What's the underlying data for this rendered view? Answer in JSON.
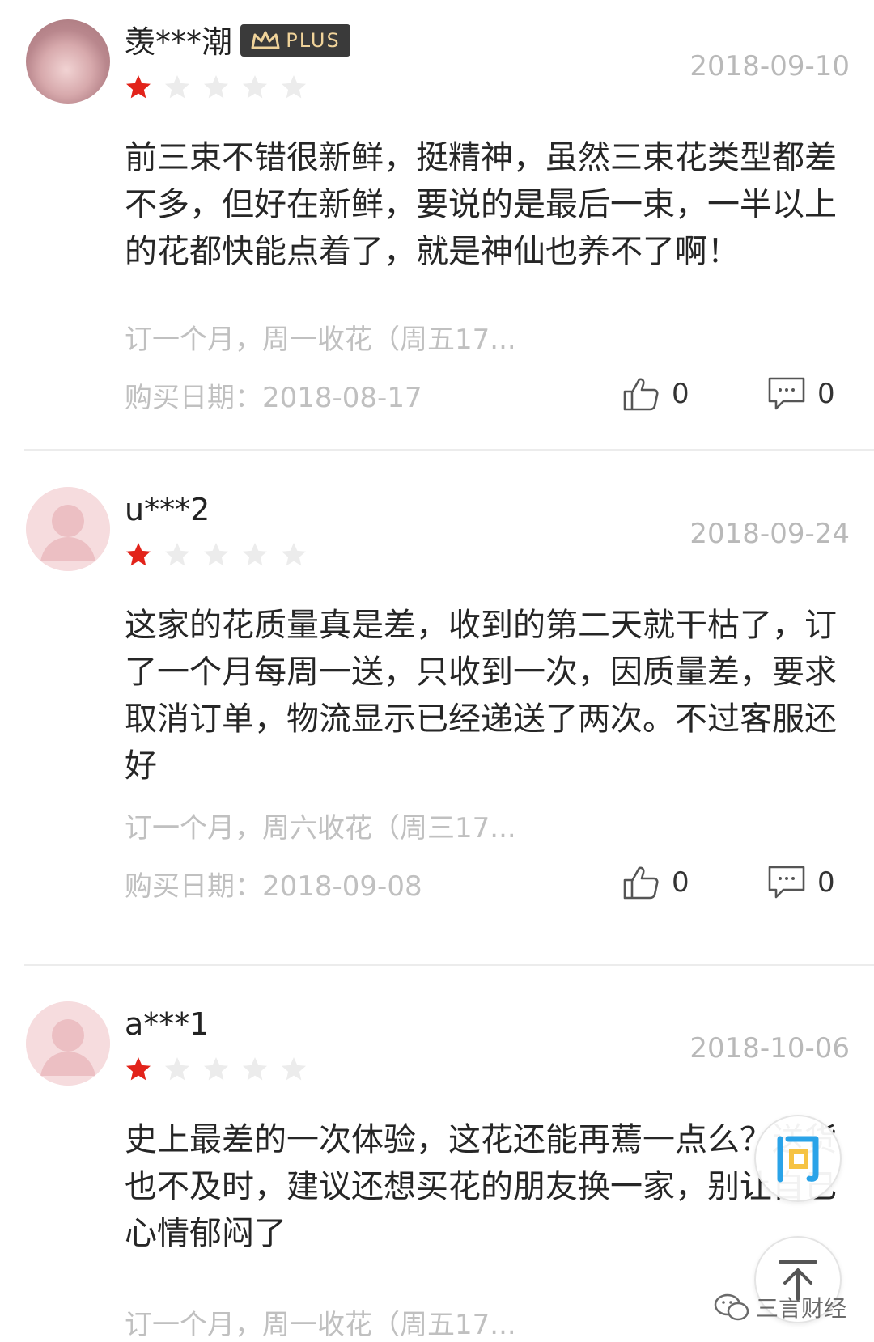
{
  "reviews": [
    {
      "username": "羡***潮",
      "plus_badge": "PLUS",
      "date": "2018-09-10",
      "rating": 1,
      "max_rating": 5,
      "content": "前三束不错很新鲜，挺精神，虽然三束花类型都差不多，但好在新鲜，要说的是最后一束，一半以上的花都快能点着了，就是神仙也养不了啊！",
      "spec": "订一个月，周一收花（周五17...",
      "purchase_date": "购买日期：2018-08-17",
      "likes": "0",
      "comments": "0"
    },
    {
      "username": "u***2",
      "date": "2018-09-24",
      "rating": 1,
      "max_rating": 5,
      "content": "这家的花质量真是差，收到的第二天就干枯了，订了一个月每周一送，只收到一次，因质量差，要求取消订单，物流显示已经递送了两次。不过客服还好",
      "spec": "订一个月，周六收花（周三17...",
      "purchase_date": "购买日期：2018-09-08",
      "likes": "0",
      "comments": "0"
    },
    {
      "username": "a***1",
      "date": "2018-10-06",
      "rating": 1,
      "max_rating": 5,
      "content": "史上最差的一次体验，这花还能再蔫一点么？送货也不及时，建议还想买花的朋友换一家，别让自己心情郁闷了",
      "spec": "订一个月，周一收花（周五17..."
    }
  ],
  "float_buttons": {
    "ask_label": "问",
    "top_icon": "back-to-top-icon"
  },
  "watermark": {
    "text": "三言财经",
    "icon": "wechat-icon"
  },
  "colors": {
    "star_active": "#e2231a",
    "star_inactive": "#ececec",
    "muted_text": "#c0c0c0",
    "plus_badge_bg": "#3a3a3a",
    "plus_badge_text": "#f0d39a",
    "ask_blue": "#2aa3e8",
    "ask_yellow": "#f6c343"
  }
}
